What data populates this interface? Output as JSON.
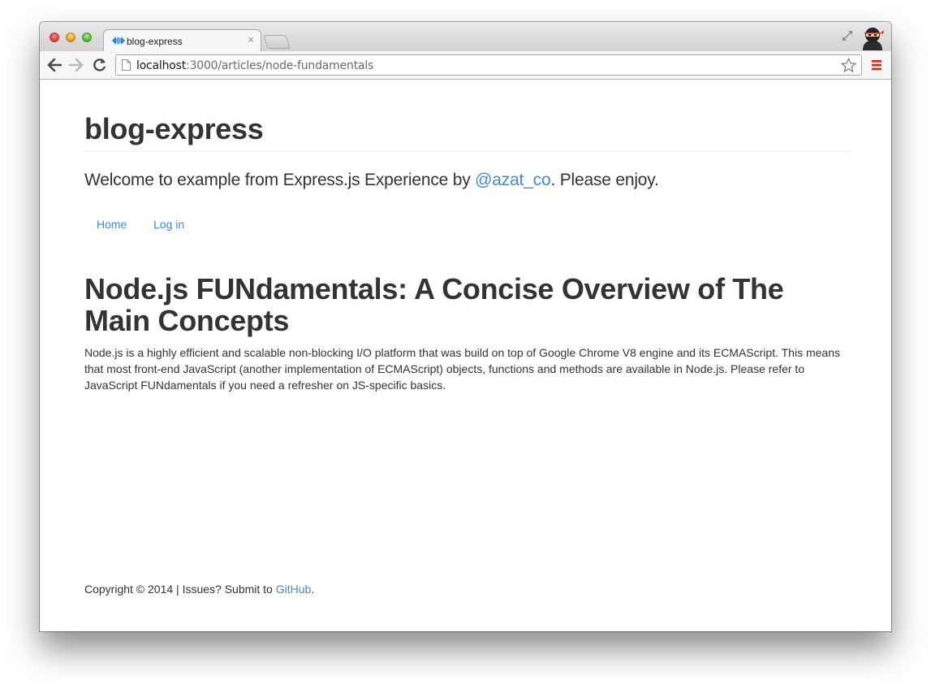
{
  "browser": {
    "tab": {
      "title": "blog-express",
      "favicon": "diamond-arrows-icon",
      "close_glyph": "×"
    },
    "address_bar": {
      "host": "localhost",
      "path": ":3000/articles/node-fundamentals"
    },
    "icons": {
      "back": "back-arrow-icon",
      "forward": "forward-arrow-icon",
      "reload": "reload-icon",
      "bookmark": "star-icon",
      "menu": "hamburger-menu-icon"
    },
    "colors": {
      "menu_icon": "#d7261d",
      "favicon": "#2a7fd4"
    }
  },
  "site": {
    "title": "blog-express",
    "lead_before": "Welcome to example from Express.js Experience by ",
    "lead_link": "@azat_co",
    "lead_after": ". Please enjoy.",
    "nav": [
      {
        "label": "Home"
      },
      {
        "label": "Log in"
      }
    ],
    "link_color": "#428bca"
  },
  "article": {
    "title": "Node.js FUNdamentals: A Concise Overview of The Main Concepts",
    "body": "Node.js is a highly efficient and scalable non-blocking I/O platform that was build on top of Google Chrome V8 engine and its ECMAScript. This means that most front-end JavaScript (another implementation of ECMAScript) objects, functions and methods are available in Node.js. Please refer to JavaScript FUNdamentals if you need a refresher on JS-specific basics."
  },
  "footer": {
    "text_before": "Copyright © 2014 | Issues? Submit to ",
    "link": "GitHub",
    "text_after": "."
  }
}
